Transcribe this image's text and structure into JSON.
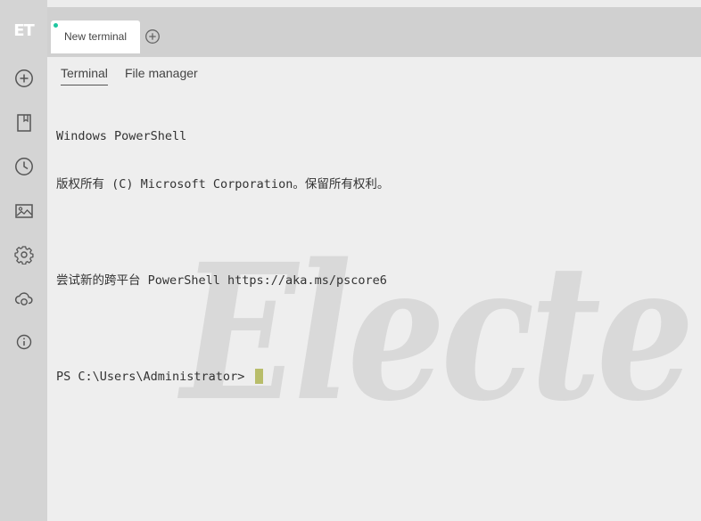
{
  "app": {
    "logo_text": "ET"
  },
  "sidebar": {
    "items": [
      {
        "name": "new-connection",
        "icon": "plus-circle-icon"
      },
      {
        "name": "bookmarks",
        "icon": "bookmark-icon"
      },
      {
        "name": "history",
        "icon": "clock-icon"
      },
      {
        "name": "background",
        "icon": "image-icon"
      },
      {
        "name": "settings",
        "icon": "gear-icon"
      },
      {
        "name": "cloud-sync",
        "icon": "cloud-sync-icon"
      },
      {
        "name": "about",
        "icon": "info-icon"
      }
    ]
  },
  "tabs": {
    "items": [
      {
        "label": "New terminal",
        "active": true,
        "status_color": "#1ec7a0"
      }
    ],
    "add_icon": "plus-circle-icon"
  },
  "subtabs": {
    "items": [
      {
        "label": "Terminal",
        "active": true
      },
      {
        "label": "File manager",
        "active": false
      }
    ]
  },
  "terminal": {
    "lines": [
      "Windows PowerShell",
      "版权所有 (C) Microsoft Corporation。保留所有权利。",
      "",
      "尝试新的跨平台 PowerShell https://aka.ms/pscore6",
      "",
      "PS C:\\Users\\Administrator> "
    ],
    "cursor_color": "#b8bd6a"
  },
  "watermark": {
    "text": "Electe"
  },
  "colors": {
    "sidebar": "#d4d4d4",
    "tabbar": "#d0d0d0",
    "content": "#eeeeee",
    "watermark": "#d9d9d9"
  }
}
